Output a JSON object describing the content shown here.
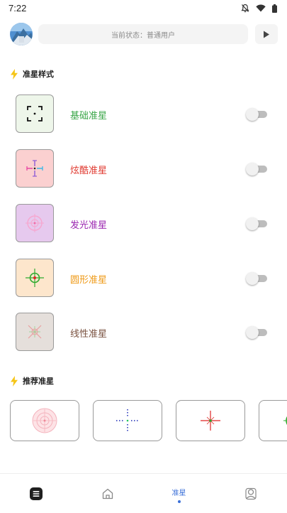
{
  "status_bar": {
    "time": "7:22",
    "icons": [
      "bell-off-icon",
      "wifi-icon",
      "battery-icon"
    ]
  },
  "header": {
    "status_text": "当前状态：普通用户",
    "play_icon": "play-icon"
  },
  "sections": {
    "styles_title": "准星样式",
    "recommend_title": "推荐准星"
  },
  "crosshair_styles": [
    {
      "label": "基础准星",
      "label_color": "#3aa648",
      "thumb_bg": "#eef6ea",
      "enabled": false
    },
    {
      "label": "炫酷准星",
      "label_color": "#e0392f",
      "thumb_bg": "#fbd0d0",
      "enabled": false
    },
    {
      "label": "发光准星",
      "label_color": "#9b27b0",
      "thumb_bg": "#e6c9ee",
      "enabled": false
    },
    {
      "label": "圆形准星",
      "label_color": "#ef9a17",
      "thumb_bg": "#fde6cc",
      "enabled": false
    },
    {
      "label": "线性准星",
      "label_color": "#7a5240",
      "thumb_bg": "#e5dfdb",
      "enabled": false
    }
  ],
  "bottom_nav": {
    "active_label": "准星",
    "items": [
      "app-logo-icon",
      "home-icon",
      "crosshair-tab",
      "profile-icon"
    ]
  },
  "colors": {
    "accent": "#3a6fd8",
    "section_icon": "#f5c518"
  }
}
